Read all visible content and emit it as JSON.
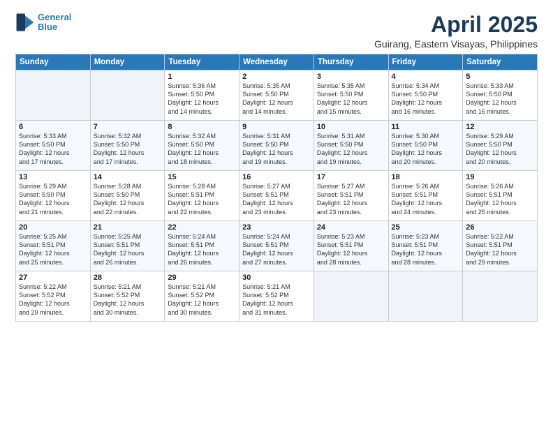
{
  "header": {
    "logo_line1": "General",
    "logo_line2": "Blue",
    "title": "April 2025",
    "subtitle": "Guirang, Eastern Visayas, Philippines"
  },
  "weekdays": [
    "Sunday",
    "Monday",
    "Tuesday",
    "Wednesday",
    "Thursday",
    "Friday",
    "Saturday"
  ],
  "weeks": [
    [
      {
        "day": "",
        "info": ""
      },
      {
        "day": "",
        "info": ""
      },
      {
        "day": "1",
        "info": "Sunrise: 5:36 AM\nSunset: 5:50 PM\nDaylight: 12 hours\nand 14 minutes."
      },
      {
        "day": "2",
        "info": "Sunrise: 5:35 AM\nSunset: 5:50 PM\nDaylight: 12 hours\nand 14 minutes."
      },
      {
        "day": "3",
        "info": "Sunrise: 5:35 AM\nSunset: 5:50 PM\nDaylight: 12 hours\nand 15 minutes."
      },
      {
        "day": "4",
        "info": "Sunrise: 5:34 AM\nSunset: 5:50 PM\nDaylight: 12 hours\nand 16 minutes."
      },
      {
        "day": "5",
        "info": "Sunrise: 5:33 AM\nSunset: 5:50 PM\nDaylight: 12 hours\nand 16 minutes."
      }
    ],
    [
      {
        "day": "6",
        "info": "Sunrise: 5:33 AM\nSunset: 5:50 PM\nDaylight: 12 hours\nand 17 minutes."
      },
      {
        "day": "7",
        "info": "Sunrise: 5:32 AM\nSunset: 5:50 PM\nDaylight: 12 hours\nand 17 minutes."
      },
      {
        "day": "8",
        "info": "Sunrise: 5:32 AM\nSunset: 5:50 PM\nDaylight: 12 hours\nand 18 minutes."
      },
      {
        "day": "9",
        "info": "Sunrise: 5:31 AM\nSunset: 5:50 PM\nDaylight: 12 hours\nand 19 minutes."
      },
      {
        "day": "10",
        "info": "Sunrise: 5:31 AM\nSunset: 5:50 PM\nDaylight: 12 hours\nand 19 minutes."
      },
      {
        "day": "11",
        "info": "Sunrise: 5:30 AM\nSunset: 5:50 PM\nDaylight: 12 hours\nand 20 minutes."
      },
      {
        "day": "12",
        "info": "Sunrise: 5:29 AM\nSunset: 5:50 PM\nDaylight: 12 hours\nand 20 minutes."
      }
    ],
    [
      {
        "day": "13",
        "info": "Sunrise: 5:29 AM\nSunset: 5:50 PM\nDaylight: 12 hours\nand 21 minutes."
      },
      {
        "day": "14",
        "info": "Sunrise: 5:28 AM\nSunset: 5:50 PM\nDaylight: 12 hours\nand 22 minutes."
      },
      {
        "day": "15",
        "info": "Sunrise: 5:28 AM\nSunset: 5:51 PM\nDaylight: 12 hours\nand 22 minutes."
      },
      {
        "day": "16",
        "info": "Sunrise: 5:27 AM\nSunset: 5:51 PM\nDaylight: 12 hours\nand 23 minutes."
      },
      {
        "day": "17",
        "info": "Sunrise: 5:27 AM\nSunset: 5:51 PM\nDaylight: 12 hours\nand 23 minutes."
      },
      {
        "day": "18",
        "info": "Sunrise: 5:26 AM\nSunset: 5:51 PM\nDaylight: 12 hours\nand 24 minutes."
      },
      {
        "day": "19",
        "info": "Sunrise: 5:26 AM\nSunset: 5:51 PM\nDaylight: 12 hours\nand 25 minutes."
      }
    ],
    [
      {
        "day": "20",
        "info": "Sunrise: 5:25 AM\nSunset: 5:51 PM\nDaylight: 12 hours\nand 25 minutes."
      },
      {
        "day": "21",
        "info": "Sunrise: 5:25 AM\nSunset: 5:51 PM\nDaylight: 12 hours\nand 26 minutes."
      },
      {
        "day": "22",
        "info": "Sunrise: 5:24 AM\nSunset: 5:51 PM\nDaylight: 12 hours\nand 26 minutes."
      },
      {
        "day": "23",
        "info": "Sunrise: 5:24 AM\nSunset: 5:51 PM\nDaylight: 12 hours\nand 27 minutes."
      },
      {
        "day": "24",
        "info": "Sunrise: 5:23 AM\nSunset: 5:51 PM\nDaylight: 12 hours\nand 28 minutes."
      },
      {
        "day": "25",
        "info": "Sunrise: 5:23 AM\nSunset: 5:51 PM\nDaylight: 12 hours\nand 28 minutes."
      },
      {
        "day": "26",
        "info": "Sunrise: 5:22 AM\nSunset: 5:51 PM\nDaylight: 12 hours\nand 29 minutes."
      }
    ],
    [
      {
        "day": "27",
        "info": "Sunrise: 5:22 AM\nSunset: 5:52 PM\nDaylight: 12 hours\nand 29 minutes."
      },
      {
        "day": "28",
        "info": "Sunrise: 5:21 AM\nSunset: 5:52 PM\nDaylight: 12 hours\nand 30 minutes."
      },
      {
        "day": "29",
        "info": "Sunrise: 5:21 AM\nSunset: 5:52 PM\nDaylight: 12 hours\nand 30 minutes."
      },
      {
        "day": "30",
        "info": "Sunrise: 5:21 AM\nSunset: 5:52 PM\nDaylight: 12 hours\nand 31 minutes."
      },
      {
        "day": "",
        "info": ""
      },
      {
        "day": "",
        "info": ""
      },
      {
        "day": "",
        "info": ""
      }
    ]
  ]
}
